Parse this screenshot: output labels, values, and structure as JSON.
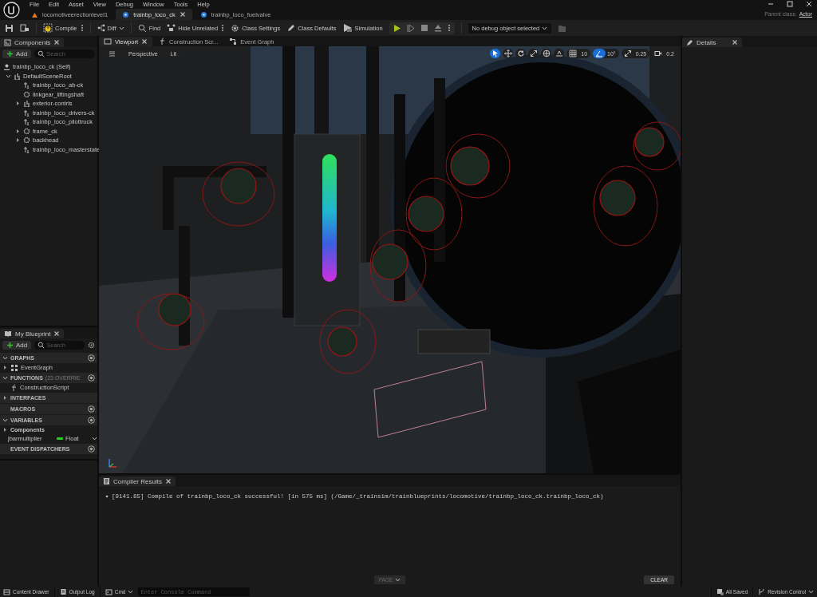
{
  "menu": [
    "File",
    "Edit",
    "Asset",
    "View",
    "Debug",
    "Window",
    "Tools",
    "Help"
  ],
  "document_tabs": [
    {
      "label": "locomotiveerectionlevel1",
      "kind": "level",
      "selected": false
    },
    {
      "label": "trainbp_loco_ck",
      "kind": "blueprint",
      "selected": true
    },
    {
      "label": "trainbp_loco_fuelvalve",
      "kind": "blueprint",
      "selected": false
    }
  ],
  "parent_class": {
    "label": "Parent class:",
    "value": "Actor"
  },
  "toolbar": [
    {
      "label": "Compile",
      "kind": "compile",
      "menu": true
    },
    {
      "label": "Diff",
      "kind": "diff",
      "menu": false
    },
    {
      "label": "Find",
      "kind": "find",
      "menu": false
    },
    {
      "label": "Hide Unrelated",
      "kind": "hide",
      "menu": true
    },
    {
      "label": "Class Settings",
      "kind": "settings",
      "menu": false
    },
    {
      "label": "Class Defaults",
      "kind": "defaults",
      "menu": false
    },
    {
      "label": "Simulation",
      "kind": "simulation",
      "menu": false
    }
  ],
  "debug_object": "No debug object selected",
  "components": {
    "title": "Components",
    "add": "Add",
    "search_placeholder": "Search",
    "self": "trainbp_loco_ck (Self)",
    "tree": [
      {
        "label": "DefaultSceneRoot",
        "kind": "scene",
        "expanded": true,
        "children": [
          {
            "label": "trainbp_loco_ab-ck",
            "kind": "component"
          },
          {
            "label": "linkgear_liftingshaft",
            "kind": "mesh"
          },
          {
            "label": "exterior-contrls",
            "kind": "scene",
            "expanded": false
          },
          {
            "label": "trainbp_loco_drivers-ck",
            "kind": "component"
          },
          {
            "label": "trainbp_loco_pilottruck",
            "kind": "component"
          },
          {
            "label": "frame_ck",
            "kind": "mesh",
            "expanded": false
          },
          {
            "label": "backhead",
            "kind": "mesh",
            "expanded": false
          },
          {
            "label": "trainbp_loco_masterstate",
            "kind": "component"
          }
        ]
      }
    ]
  },
  "my_blueprint": {
    "title": "My Blueprint",
    "add": "Add",
    "search_placeholder": "Search",
    "sections": [
      {
        "title": "GRAPHS",
        "expanded": true,
        "add": true,
        "items": [
          {
            "label": "EventGraph",
            "kind": "graph",
            "expanded": false
          }
        ]
      },
      {
        "title": "FUNCTIONS",
        "note": "(23 OVERRIE",
        "expanded": true,
        "add": true,
        "items": [
          {
            "label": "ConstructionScript",
            "kind": "function"
          }
        ]
      },
      {
        "title": "INTERFACES",
        "expanded": false,
        "add": false
      },
      {
        "title": "MACROS",
        "add": true
      },
      {
        "title": "VARIABLES",
        "expanded": true,
        "add": true,
        "items": [
          {
            "label": "Components",
            "kind": "category",
            "expanded": false
          },
          {
            "label": "jbarmultiplier",
            "kind": "variable",
            "type": "Float",
            "color": "#22d422"
          }
        ]
      },
      {
        "title": "EVENT DISPATCHERS",
        "add": true
      }
    ]
  },
  "editor_tabs": [
    {
      "label": "Viewport",
      "kind": "viewport",
      "selected": true
    },
    {
      "label": "Construction Scr...",
      "kind": "function",
      "selected": false
    },
    {
      "label": "Event Graph",
      "kind": "graph",
      "selected": false
    }
  ],
  "viewport": {
    "view_mode": "Perspective",
    "lighting": "Lit",
    "tools": [
      {
        "kind": "select",
        "selected": true
      },
      {
        "kind": "move",
        "selected": false
      },
      {
        "kind": "rotate",
        "selected": false
      },
      {
        "kind": "scale",
        "selected": false
      }
    ],
    "snaps": [
      {
        "kind": "grid",
        "value": "10",
        "on": false
      },
      {
        "kind": "angle",
        "value": "10°",
        "on": true
      },
      {
        "kind": "scale",
        "value": "0.25",
        "on": false
      },
      {
        "kind": "camera",
        "value": "0.2"
      }
    ]
  },
  "compiler_results": {
    "title": "Compiler Results",
    "messages": [
      "[9141.85] Compile of trainbp_loco_ck successful! [in 575 ms] (/Game/_trainsim/trainblueprints/locomotive/trainbp_loco_ck.trainbp_loco_ck)"
    ],
    "page": {
      "label": "PAGE",
      "disabled": true
    },
    "clear": "CLEAR"
  },
  "details": {
    "title": "Details"
  },
  "status_bar": {
    "content_drawer": "Content Drawer",
    "output_log": "Output Log",
    "cmd": "Cmd",
    "console_placeholder": "Enter Console Command",
    "saved": "All Saved",
    "revision_control": "Revision Control"
  }
}
